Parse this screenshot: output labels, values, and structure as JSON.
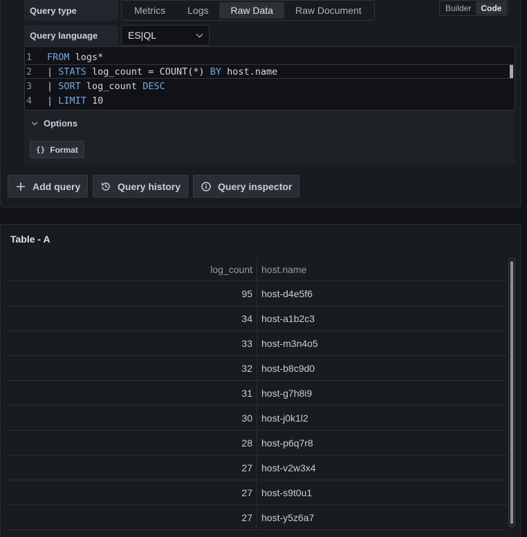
{
  "editor": {
    "query_type_label": "Query type",
    "query_type_options": [
      "Metrics",
      "Logs",
      "Raw Data",
      "Raw Document"
    ],
    "query_type_selected": "Raw Data",
    "mode_options": [
      "Builder",
      "Code"
    ],
    "mode_selected": "Code",
    "query_language_label": "Query language",
    "query_language_value": "ES|QL",
    "line_numbers": [
      "1",
      "2",
      "3",
      "4"
    ],
    "code_lines": [
      "FROM logs*",
      "| STATS log_count = COUNT(*) BY host.name",
      "| SORT log_count DESC",
      "| LIMIT 10"
    ],
    "options_label": "Options",
    "format_icon": "{}",
    "format_label": "Format"
  },
  "actions": {
    "add_query": "Add query",
    "query_history": "Query history",
    "query_inspector": "Query inspector"
  },
  "table": {
    "title": "Table - A",
    "columns": [
      "log_count",
      "host.name"
    ],
    "rows": [
      {
        "log_count": "95",
        "host": "host-d4e5f6"
      },
      {
        "log_count": "34",
        "host": "host-a1b2c3"
      },
      {
        "log_count": "33",
        "host": "host-m3n4o5"
      },
      {
        "log_count": "32",
        "host": "host-b8c9d0"
      },
      {
        "log_count": "31",
        "host": "host-g7h8i9"
      },
      {
        "log_count": "30",
        "host": "host-j0k1l2"
      },
      {
        "log_count": "28",
        "host": "host-p6q7r8"
      },
      {
        "log_count": "27",
        "host": "host-v2w3x4"
      },
      {
        "log_count": "27",
        "host": "host-s9t0u1"
      },
      {
        "log_count": "27",
        "host": "host-y5z6a7"
      }
    ]
  },
  "colors": {
    "background": "#111217",
    "panel": "#181b1f",
    "keyword": "#6fa9e6"
  }
}
